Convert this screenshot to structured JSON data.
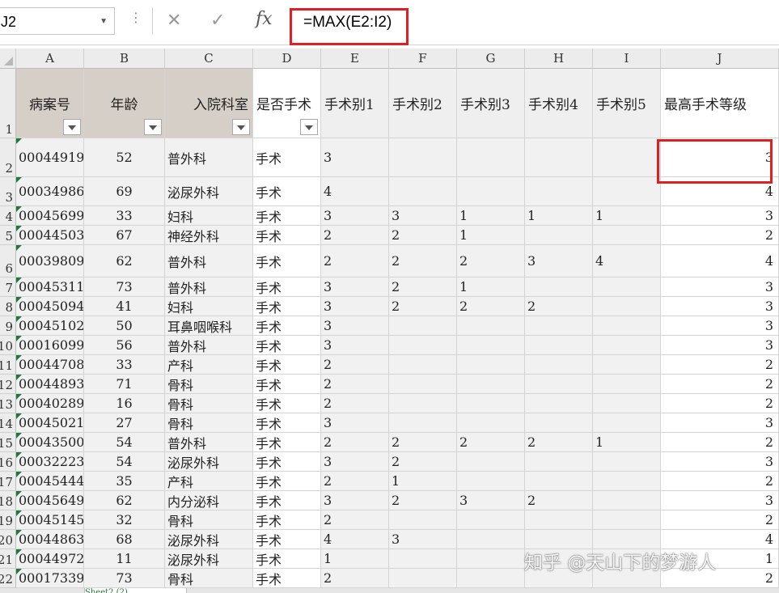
{
  "formula_bar": {
    "name_box": "J2",
    "formula": "=MAX(E2:I2)",
    "cancel_icon": "✕",
    "confirm_icon": "✓",
    "fx_label": "fx"
  },
  "columns": [
    "A",
    "B",
    "C",
    "D",
    "E",
    "F",
    "G",
    "H",
    "I",
    "J"
  ],
  "headers": [
    "病案号",
    "年龄",
    "入院科室",
    "是否手术",
    "手术别1",
    "手术别2",
    "手术别3",
    "手术别4",
    "手术别5",
    "最高手术等级"
  ],
  "rows": [
    {
      "n": "2",
      "c": [
        "00044919",
        "52",
        "普外科",
        "手术",
        "3",
        "",
        "",
        "",
        "",
        "3"
      ]
    },
    {
      "n": "3",
      "c": [
        "00034986",
        "69",
        "泌尿外科",
        "手术",
        "4",
        "",
        "",
        "",
        "",
        "4"
      ]
    },
    {
      "n": "4",
      "c": [
        "00045699",
        "33",
        "妇科",
        "手术",
        "3",
        "3",
        "1",
        "1",
        "1",
        "3"
      ]
    },
    {
      "n": "5",
      "c": [
        "00044503",
        "67",
        "神经外科",
        "手术",
        "2",
        "2",
        "1",
        "",
        "",
        "2"
      ]
    },
    {
      "n": "6",
      "c": [
        "00039809",
        "62",
        "普外科",
        "手术",
        "2",
        "2",
        "2",
        "3",
        "4",
        "4"
      ]
    },
    {
      "n": "7",
      "c": [
        "00045311",
        "73",
        "普外科",
        "手术",
        "3",
        "2",
        "1",
        "",
        "",
        "3"
      ]
    },
    {
      "n": "8",
      "c": [
        "00045094",
        "41",
        "妇科",
        "手术",
        "3",
        "2",
        "2",
        "2",
        "",
        "3"
      ]
    },
    {
      "n": "9",
      "c": [
        "00045102",
        "50",
        "耳鼻咽喉科",
        "手术",
        "3",
        "",
        "",
        "",
        "",
        "3"
      ]
    },
    {
      "n": "10",
      "c": [
        "00016099",
        "56",
        "普外科",
        "手术",
        "3",
        "",
        "",
        "",
        "",
        "3"
      ]
    },
    {
      "n": "11",
      "c": [
        "00044708",
        "33",
        "产科",
        "手术",
        "2",
        "",
        "",
        "",
        "",
        "2"
      ]
    },
    {
      "n": "12",
      "c": [
        "00044893",
        "71",
        "骨科",
        "手术",
        "2",
        "",
        "",
        "",
        "",
        "2"
      ]
    },
    {
      "n": "13",
      "c": [
        "00040289",
        "16",
        "骨科",
        "手术",
        "2",
        "",
        "",
        "",
        "",
        "2"
      ]
    },
    {
      "n": "14",
      "c": [
        "00045021",
        "27",
        "骨科",
        "手术",
        "3",
        "",
        "",
        "",
        "",
        "3"
      ]
    },
    {
      "n": "15",
      "c": [
        "00043500",
        "54",
        "普外科",
        "手术",
        "2",
        "2",
        "2",
        "2",
        "1",
        "2"
      ]
    },
    {
      "n": "16",
      "c": [
        "00032223",
        "54",
        "泌尿外科",
        "手术",
        "3",
        "2",
        "",
        "",
        "",
        "3"
      ]
    },
    {
      "n": "17",
      "c": [
        "00045444",
        "35",
        "产科",
        "手术",
        "2",
        "1",
        "",
        "",
        "",
        "2"
      ]
    },
    {
      "n": "18",
      "c": [
        "00045649",
        "62",
        "内分泌科",
        "手术",
        "3",
        "2",
        "3",
        "2",
        "",
        "3"
      ]
    },
    {
      "n": "19",
      "c": [
        "00045145",
        "32",
        "骨科",
        "手术",
        "2",
        "",
        "",
        "",
        "",
        "2"
      ]
    },
    {
      "n": "20",
      "c": [
        "00044863",
        "68",
        "泌尿外科",
        "手术",
        "4",
        "3",
        "",
        "",
        "",
        "4"
      ]
    },
    {
      "n": "21",
      "c": [
        "00044972",
        "11",
        "泌尿外科",
        "手术",
        "1",
        "",
        "",
        "",
        "",
        "1"
      ]
    },
    {
      "n": "22",
      "c": [
        "00017339",
        "73",
        "骨科",
        "手术",
        "2",
        "",
        "",
        "",
        "",
        "2"
      ]
    }
  ],
  "header_row_number": "1",
  "watermark": "知乎 @天山下的梦游人",
  "sheet_tab": "Sheet2 (2)",
  "colors": {
    "red_highlight": "#e02020",
    "header_tan": "#d5cfc8",
    "band_gray": "#f1f1f1",
    "triangle_green": "#1e7a38"
  }
}
